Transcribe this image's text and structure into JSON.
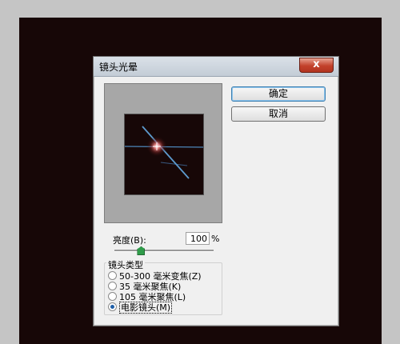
{
  "dialog": {
    "title": "镜头光晕",
    "close_symbol": "x",
    "ok_label": "确定",
    "cancel_label": "取消"
  },
  "brightness": {
    "label": "亮度(B):",
    "value": "100",
    "unit": "%",
    "slider_fraction": 0.27
  },
  "lens_type": {
    "title": "镜头类型",
    "options": [
      {
        "label": "50-300 毫米变焦(Z)",
        "selected": false
      },
      {
        "label": "35 毫米聚焦(K)",
        "selected": false
      },
      {
        "label": "105 毫米聚焦(L)",
        "selected": false
      },
      {
        "label": "电影镜头(M)",
        "selected": true
      }
    ]
  },
  "colors": {
    "canvas": "#170707",
    "dialog": "#f0f0f0",
    "close_button": "#c2412b",
    "flare_streak": "#5aa6e6"
  }
}
